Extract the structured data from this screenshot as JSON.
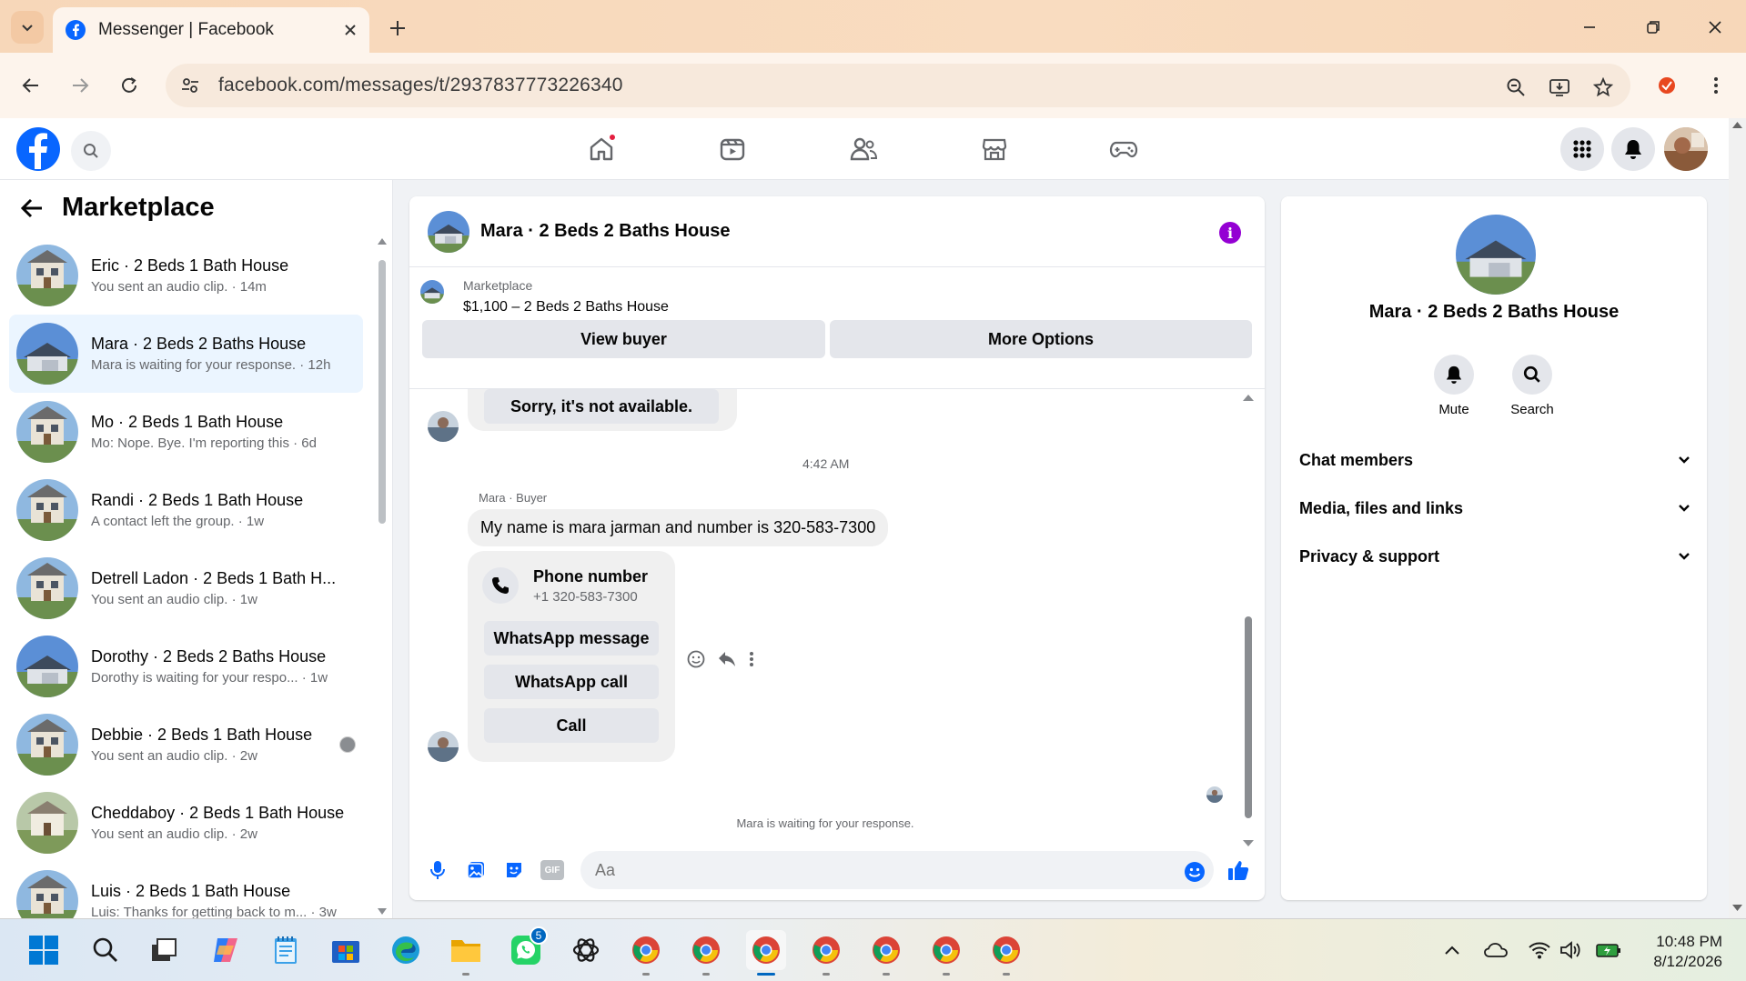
{
  "browser": {
    "tab_title": "Messenger | Facebook",
    "url": "facebook.com/messages/t/2937837773226340"
  },
  "sidebar": {
    "title": "Marketplace",
    "conversations": [
      {
        "name": "Eric · 2 Beds 1 Bath House",
        "subtitle": "You sent an audio clip. · 14m"
      },
      {
        "name": "Mara · 2 Beds 2 Baths House",
        "subtitle": "Mara is waiting for your response. · 12h"
      },
      {
        "name": "Mo · 2 Beds 1 Bath House",
        "subtitle": "Mo: Nope. Bye. I'm reporting this · 6d"
      },
      {
        "name": "Randi · 2 Beds 1 Bath House",
        "subtitle": "A contact left the group. · 1w"
      },
      {
        "name": "Detrell Ladon · 2 Beds 1 Bath H...",
        "subtitle": "You sent an audio clip. · 1w"
      },
      {
        "name": "Dorothy · 2 Beds 2 Baths House",
        "subtitle": "Dorothy is waiting for your respo... · 1w"
      },
      {
        "name": "Debbie · 2 Beds 1 Bath House",
        "subtitle": "You sent an audio clip. · 2w"
      },
      {
        "name": "Cheddaboy · 2 Beds 1 Bath House",
        "subtitle": "You sent an audio clip. · 2w"
      },
      {
        "name": "Luis · 2 Beds 1 Bath House",
        "subtitle": "Luis: Thanks for getting back to m... · 3w"
      }
    ]
  },
  "chat": {
    "title": "Mara · 2 Beds 2 Baths House",
    "listing_label": "Marketplace",
    "listing_price": "$1,100 – 2 Beds 2 Baths House",
    "view_buyer": "View buyer",
    "more_options": "More Options",
    "prev_bubble": "Sorry, it's not available.",
    "timestamp": "4:42 AM",
    "sender_label": "Mara · Buyer",
    "message": "My name is mara jarman and number is 320-583-7300",
    "phone_card_title": "Phone number",
    "phone_card_number": "+1 320-583-7300",
    "whatsapp_message": "WhatsApp message",
    "whatsapp_call": "WhatsApp call",
    "call": "Call",
    "status": "Mara is waiting for your response.",
    "composer_placeholder": "Aa",
    "gif_label": "GIF"
  },
  "right_panel": {
    "name": "Mara · 2 Beds 2 Baths House",
    "mute": "Mute",
    "search": "Search",
    "sections": [
      "Chat members",
      "Media, files and links",
      "Privacy & support"
    ]
  },
  "taskbar": {
    "whatsapp_badge": "5",
    "time": "10:48 PM",
    "date": "8/12/2026"
  },
  "colors": {
    "facebook_blue": "#0866ff",
    "info_purple": "#9400d3",
    "active_row": "#ebf5ff"
  }
}
